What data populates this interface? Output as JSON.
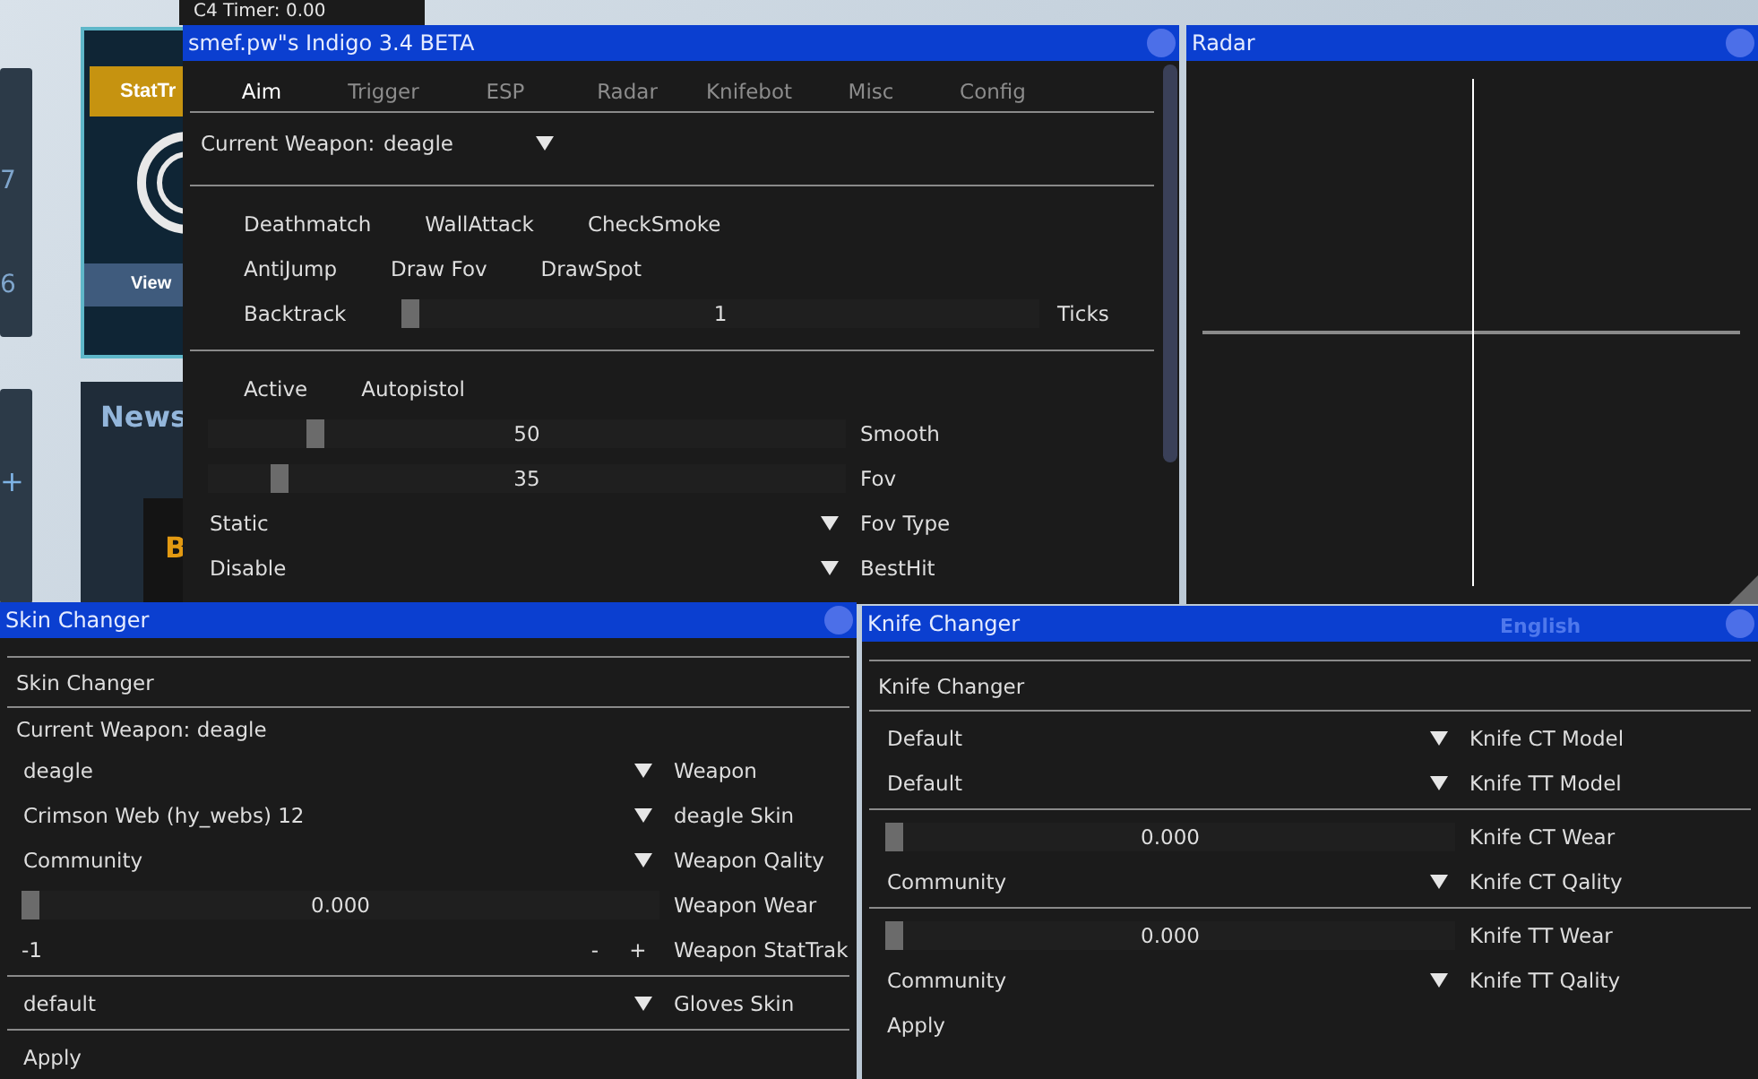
{
  "background": {
    "c4_timer": "C4 Timer: 0.00",
    "stattrak": "StatTr",
    "view": "View",
    "news": "News",
    "side_numbers": [
      "7",
      "6"
    ],
    "plus": "+",
    "promo_letter": "B",
    "language": "English"
  },
  "main_window": {
    "title": "smef.pw\"s Indigo 3.4 BETA",
    "tabs": [
      {
        "label": "Aim",
        "selected": true
      },
      {
        "label": "Trigger",
        "selected": false
      },
      {
        "label": "ESP",
        "selected": false
      },
      {
        "label": "Radar",
        "selected": false
      },
      {
        "label": "Knifebot",
        "selected": false
      },
      {
        "label": "Misc",
        "selected": false
      },
      {
        "label": "Config",
        "selected": false
      }
    ],
    "rows": [
      {
        "kind": "weapon_select",
        "label": "Current Weapon:",
        "value": "deagle"
      },
      {
        "kind": "separator"
      },
      {
        "kind": "labels",
        "items": [
          "Deathmatch",
          "WallAttack",
          "CheckSmoke"
        ]
      },
      {
        "kind": "labels",
        "items": [
          "AntiJump",
          "Draw Fov",
          "DrawSpot"
        ]
      },
      {
        "kind": "slider",
        "label": "Backtrack",
        "level": 0,
        "value": "1",
        "caption": "Ticks"
      },
      {
        "kind": "separator"
      },
      {
        "kind": "labels",
        "items": [
          "Active",
          "Autopistol"
        ]
      },
      {
        "kind": "slider",
        "level": 0.16,
        "value": "50",
        "caption": "Smooth"
      },
      {
        "kind": "slider",
        "level": 0.1,
        "value": "35",
        "caption": "Fov"
      },
      {
        "kind": "combo",
        "value": "Static",
        "caption": "Fov Type"
      },
      {
        "kind": "combo",
        "value": "Disable",
        "caption": "BestHit"
      }
    ]
  },
  "radar_window": {
    "title": "Radar"
  },
  "skin_window": {
    "title": "Skin Changer",
    "rows": [
      {
        "kind": "separator"
      },
      {
        "kind": "heading",
        "text": "Skin Changer"
      },
      {
        "kind": "separator"
      },
      {
        "kind": "text",
        "text": "Current Weapon: deagle"
      },
      {
        "kind": "combo",
        "value": "deagle",
        "caption": "Weapon"
      },
      {
        "kind": "combo",
        "value": "Crimson Web (hy_webs) 12",
        "caption": "deagle Skin"
      },
      {
        "kind": "combo",
        "value": "Community",
        "caption": "Weapon Qality"
      },
      {
        "kind": "slider",
        "level": 0,
        "value": "0.000",
        "caption": "Weapon Wear"
      },
      {
        "kind": "counter",
        "value": "-1",
        "minus": "-",
        "plus": "+",
        "caption": "Weapon StatTrak"
      },
      {
        "kind": "separator"
      },
      {
        "kind": "combo",
        "value": "default",
        "caption": "Gloves Skin"
      },
      {
        "kind": "separator"
      },
      {
        "kind": "button",
        "label": "Apply"
      }
    ]
  },
  "knife_window": {
    "title": "Knife Changer",
    "rows": [
      {
        "kind": "separator"
      },
      {
        "kind": "heading",
        "text": "Knife Changer"
      },
      {
        "kind": "separator"
      },
      {
        "kind": "combo",
        "value": "Default",
        "caption": "Knife CT Model"
      },
      {
        "kind": "combo",
        "value": "Default",
        "caption": "Knife TT Model"
      },
      {
        "kind": "separator"
      },
      {
        "kind": "slider",
        "level": 0,
        "value": "0.000",
        "caption": "Knife CT Wear"
      },
      {
        "kind": "combo",
        "value": "Community",
        "caption": "Knife CT Qality"
      },
      {
        "kind": "separator"
      },
      {
        "kind": "slider",
        "level": 0,
        "value": "0.000",
        "caption": "Knife TT Wear"
      },
      {
        "kind": "combo",
        "value": "Community",
        "caption": "Knife TT Qality"
      },
      {
        "kind": "button",
        "label": "Apply"
      }
    ]
  }
}
